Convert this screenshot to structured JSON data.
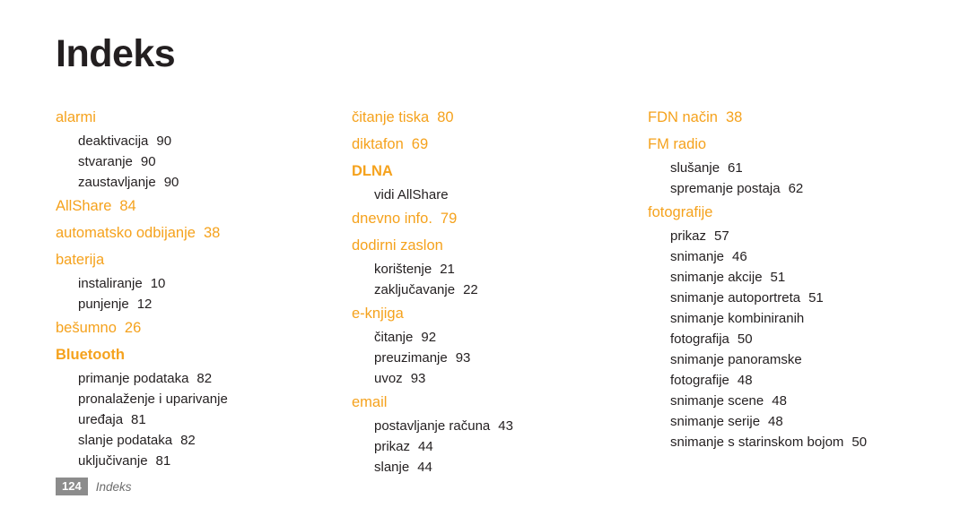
{
  "page": {
    "title": "Indeks",
    "folio": "124",
    "footer_label": "Indeks"
  },
  "colors": {
    "heading": "#f5a21d",
    "text": "#231f20",
    "folio_bg": "#8c8c8c",
    "footer_label": "#6d6d6d"
  },
  "columns": [
    {
      "entries": [
        {
          "term": "alarmi",
          "page": "",
          "bold": false,
          "subs": [
            {
              "text": "deaktivacija",
              "page": "90"
            },
            {
              "text": "stvaranje",
              "page": "90"
            },
            {
              "text": "zaustavljanje",
              "page": "90"
            }
          ]
        },
        {
          "term": "AllShare",
          "page": "84",
          "bold": false,
          "subs": []
        },
        {
          "term": "automatsko odbijanje",
          "page": "38",
          "bold": false,
          "subs": []
        },
        {
          "term": "baterija",
          "page": "",
          "bold": false,
          "subs": [
            {
              "text": "instaliranje",
              "page": "10"
            },
            {
              "text": "punjenje",
              "page": "12"
            }
          ]
        },
        {
          "term": "bešumno",
          "page": "26",
          "bold": false,
          "subs": []
        },
        {
          "term": "Bluetooth",
          "page": "",
          "bold": true,
          "subs": [
            {
              "text": "primanje podataka",
              "page": "82"
            },
            {
              "text": "pronalaženje i uparivanje",
              "page": ""
            },
            {
              "text": "uređaja",
              "page": "81"
            },
            {
              "text": "slanje podataka",
              "page": "82"
            },
            {
              "text": "uključivanje",
              "page": "81"
            }
          ]
        }
      ]
    },
    {
      "entries": [
        {
          "term": "čitanje tiska",
          "page": "80",
          "bold": false,
          "subs": []
        },
        {
          "term": "diktafon",
          "page": "69",
          "bold": false,
          "subs": []
        },
        {
          "term": "DLNA",
          "page": "",
          "bold": true,
          "subs": [
            {
              "text": "vidi AllShare",
              "page": ""
            }
          ]
        },
        {
          "term": "dnevno info.",
          "page": "79",
          "bold": false,
          "subs": []
        },
        {
          "term": "dodirni zaslon",
          "page": "",
          "bold": false,
          "subs": [
            {
              "text": "korištenje",
              "page": "21"
            },
            {
              "text": "zaključavanje",
              "page": "22"
            }
          ]
        },
        {
          "term": "e-knjiga",
          "page": "",
          "bold": false,
          "subs": [
            {
              "text": "čitanje",
              "page": "92"
            },
            {
              "text": "preuzimanje",
              "page": "93"
            },
            {
              "text": "uvoz",
              "page": "93"
            }
          ]
        },
        {
          "term": "email",
          "page": "",
          "bold": false,
          "subs": [
            {
              "text": "postavljanje računa",
              "page": "43"
            },
            {
              "text": "prikaz",
              "page": "44"
            },
            {
              "text": "slanje",
              "page": "44"
            }
          ]
        }
      ]
    },
    {
      "entries": [
        {
          "term": "FDN način",
          "page": "38",
          "bold": false,
          "subs": []
        },
        {
          "term": "FM radio",
          "page": "",
          "bold": false,
          "subs": [
            {
              "text": "slušanje",
              "page": "61"
            },
            {
              "text": "spremanje postaja",
              "page": "62"
            }
          ]
        },
        {
          "term": "fotografije",
          "page": "",
          "bold": false,
          "subs": [
            {
              "text": "prikaz",
              "page": "57"
            },
            {
              "text": "snimanje",
              "page": "46"
            },
            {
              "text": "snimanje akcije",
              "page": "51"
            },
            {
              "text": "snimanje autoportreta",
              "page": "51"
            },
            {
              "text": "snimanje kombiniranih",
              "page": ""
            },
            {
              "text": "fotografija",
              "page": "50"
            },
            {
              "text": "snimanje panoramske",
              "page": ""
            },
            {
              "text": "fotografije",
              "page": "48"
            },
            {
              "text": "snimanje scene",
              "page": "48"
            },
            {
              "text": "snimanje serije",
              "page": "48"
            },
            {
              "text": "snimanje s starinskom bojom",
              "page": "50"
            }
          ]
        }
      ]
    }
  ]
}
